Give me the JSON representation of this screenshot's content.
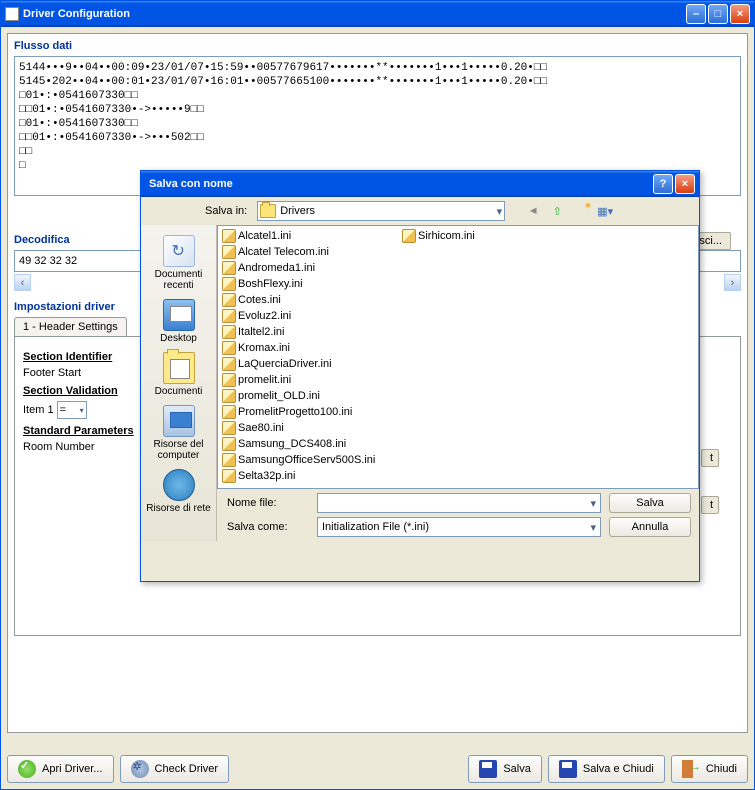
{
  "mainWindow": {
    "title": "Driver Configuration"
  },
  "sections": {
    "flussoDati": {
      "label": "Flusso dati",
      "text": "5144•••9••04••00:09•23/01/07•15:59••00577679617•••••••**•••••••1•••1•••••0.20•□□\n5145•202••04••00:01•23/01/07•16:01••00577665100•••••••**•••••••1•••1•••••0.20•□□\n□01•:•0541607330□□\n□□01•:•0541607330•->•••••9□□\n□01•:•0541607330□□\n□□01•:•0541607330•->•••502□□\n□□\n□"
    },
    "decodifica": {
      "label": "Decodifica",
      "text": "49 32 32 32"
    },
    "impostazioni": {
      "label": "Impostazioni driver",
      "tab": "1 - Header Settings",
      "sectionIdent": "Section Identifier",
      "footerStart": "Footer Start",
      "sectionValida": "Section Validation",
      "item1": "Item 1",
      "standardPara": "Standard Parameters",
      "roomNumber": "Room Number",
      "acquisisci": "cquisisci..."
    }
  },
  "bottom": {
    "apri": "Apri Driver...",
    "check": "Check Driver",
    "salva": "Salva",
    "salvaChiudi": "Salva e Chiudi",
    "chiudi": "Chiudi"
  },
  "saveDialog": {
    "title": "Salva con nome",
    "salvaInLabel": "Salva in:",
    "salvaInValue": "Drivers",
    "places": {
      "recent": "Documenti recenti",
      "desktop": "Desktop",
      "docs": "Documenti",
      "computer": "Risorse del computer",
      "net": "Risorse di rete"
    },
    "files": [
      "Alcatel1.ini",
      "Alcatel Telecom.ini",
      "Andromeda1.ini",
      "BoshFlexy.ini",
      "Cotes.ini",
      "Evoluz2.ini",
      "Italtel2.ini",
      "Kromax.ini",
      "LaQuerciaDriver.ini",
      "promelit.ini",
      "promelit_OLD.ini",
      "PromelitProgetto100.ini",
      "Sae80.ini",
      "Samsung_DCS408.ini",
      "SamsungOfficeServ500S.ini",
      "Selta32p.ini",
      "Sirhicom.ini"
    ],
    "nomeFileLabel": "Nome file:",
    "nomeFileValue": "",
    "salvaComeLabel": "Salva come:",
    "salvaComeValue": "Initialization File (*.ini)",
    "salvaBtn": "Salva",
    "annullaBtn": "Annulla"
  }
}
